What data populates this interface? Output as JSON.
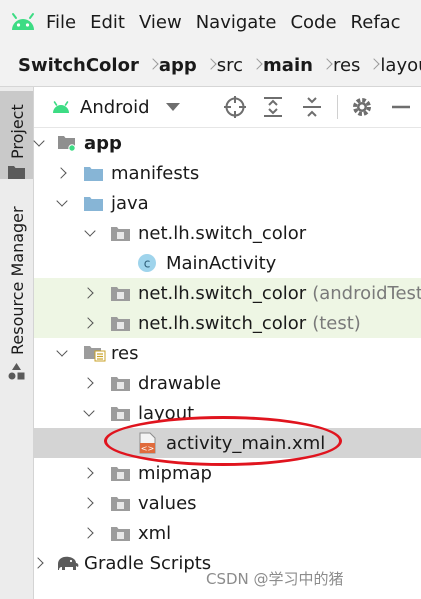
{
  "menu": [
    "File",
    "Edit",
    "View",
    "Navigate",
    "Code",
    "Refac"
  ],
  "breadcrumb": [
    "SwitchColor",
    "app",
    "src",
    "main",
    "res",
    "layou"
  ],
  "tool_strip": {
    "project": "Project",
    "resource_manager": "Resource Manager"
  },
  "panel": {
    "view_mode": "Android"
  },
  "tree": [
    {
      "label": "app",
      "bold": true
    },
    {
      "label": "manifests"
    },
    {
      "label": "java"
    },
    {
      "label": "net.lh.switch_color"
    },
    {
      "label": "MainActivity"
    },
    {
      "label": "net.lh.switch_color",
      "hint": "(androidTest)"
    },
    {
      "label": "net.lh.switch_color",
      "hint": "(test)"
    },
    {
      "label": "res"
    },
    {
      "label": "drawable"
    },
    {
      "label": "layout"
    },
    {
      "label": "activity_main.xml"
    },
    {
      "label": "mipmap"
    },
    {
      "label": "values"
    },
    {
      "label": "xml"
    },
    {
      "label": "Gradle Scripts"
    }
  ],
  "watermark": "CSDN @学习中的猪",
  "colors": {
    "selection": "#d4d4d4",
    "test_source_bg": "#eef6e4",
    "annotation": "#e0141e",
    "folder": "#87b5d6",
    "android_green": "#3ddc84"
  }
}
